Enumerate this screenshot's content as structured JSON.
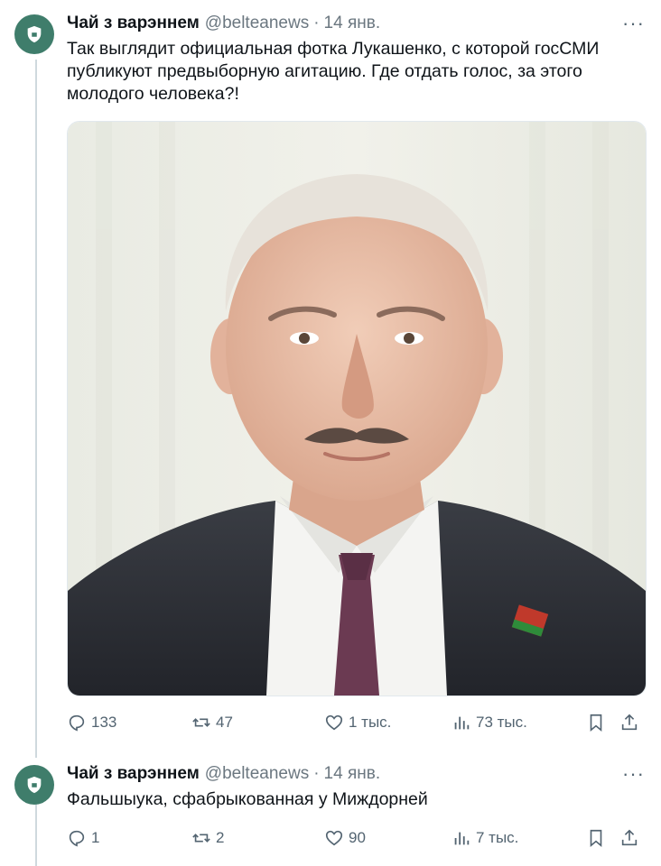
{
  "tweets": [
    {
      "author": {
        "name": "Чай з варэннем",
        "handle": "@belteanews"
      },
      "date": "14 янв.",
      "text": "Так выглядит официальная фотка Лукашенко, с которой госСМИ публикуют предвыборную агитацию. Где отдать голос, за этого молодого человека?!",
      "media": {
        "type": "portrait-photo",
        "description_icon": "portrait-photo"
      },
      "stats": {
        "replies": "133",
        "retweets": "47",
        "likes": "1 тыс.",
        "views": "73 тыс."
      }
    },
    {
      "author": {
        "name": "Чай з варэннем",
        "handle": "@belteanews"
      },
      "date": "14 янв.",
      "text": "Фальшыука, сфабрыкованная у Миждорней",
      "stats": {
        "replies": "1",
        "retweets": "2",
        "likes": "90",
        "views": "7 тыс."
      }
    }
  ],
  "icons": [
    "reply-icon",
    "retweet-icon",
    "like-icon",
    "views-icon",
    "bookmark-icon",
    "share-icon",
    "more-icon"
  ],
  "colors": {
    "muted": "#536471",
    "text": "#0f1419",
    "avatar_bg": "#3f7d6b"
  }
}
